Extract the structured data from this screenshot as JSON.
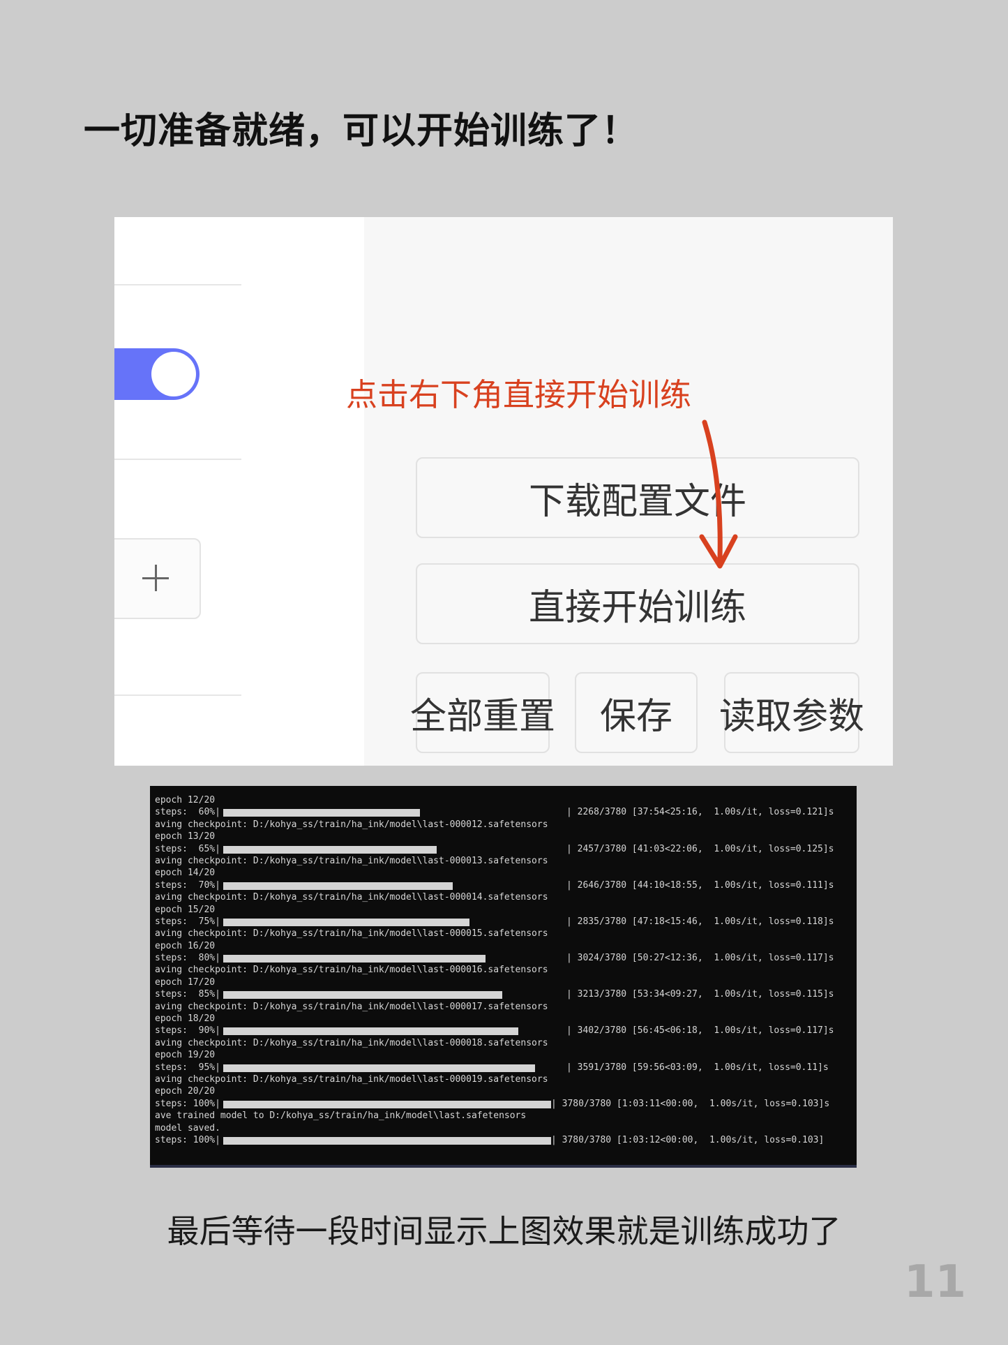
{
  "headline": "一切准备就绪，可以开始训练了！",
  "annotation": "点击右下角直接开始训练",
  "buttons": {
    "download_config": "下载配置文件",
    "start_training": "直接开始训练",
    "reset_all": "全部重置",
    "save": "保存",
    "load_params": "读取参数"
  },
  "colors": {
    "toggle_on": "#6673f9",
    "annotation": "#d8411f",
    "terminal_bg": "#0c0c0c"
  },
  "terminal": {
    "lines": [
      {
        "kind": "text",
        "text": "epoch 12/20"
      },
      {
        "kind": "steps",
        "label": "steps:  60%|",
        "progress": 0.6,
        "info": "| 2268/3780 [37:54<25:16,  1.00s/it, loss=0.121]s"
      },
      {
        "kind": "text",
        "text": "aving checkpoint: D:/kohya_ss/train/ha_ink/model\\last-000012.safetensors"
      },
      {
        "kind": "text",
        "text": "epoch 13/20"
      },
      {
        "kind": "steps",
        "label": "steps:  65%|",
        "progress": 0.65,
        "info": "| 2457/3780 [41:03<22:06,  1.00s/it, loss=0.125]s"
      },
      {
        "kind": "text",
        "text": "aving checkpoint: D:/kohya_ss/train/ha_ink/model\\last-000013.safetensors"
      },
      {
        "kind": "text",
        "text": "epoch 14/20"
      },
      {
        "kind": "steps",
        "label": "steps:  70%|",
        "progress": 0.7,
        "info": "| 2646/3780 [44:10<18:55,  1.00s/it, loss=0.111]s"
      },
      {
        "kind": "text",
        "text": "aving checkpoint: D:/kohya_ss/train/ha_ink/model\\last-000014.safetensors"
      },
      {
        "kind": "text",
        "text": "epoch 15/20"
      },
      {
        "kind": "steps",
        "label": "steps:  75%|",
        "progress": 0.75,
        "info": "| 2835/3780 [47:18<15:46,  1.00s/it, loss=0.118]s"
      },
      {
        "kind": "text",
        "text": "aving checkpoint: D:/kohya_ss/train/ha_ink/model\\last-000015.safetensors"
      },
      {
        "kind": "text",
        "text": "epoch 16/20"
      },
      {
        "kind": "steps",
        "label": "steps:  80%|",
        "progress": 0.8,
        "info": "| 3024/3780 [50:27<12:36,  1.00s/it, loss=0.117]s"
      },
      {
        "kind": "text",
        "text": "aving checkpoint: D:/kohya_ss/train/ha_ink/model\\last-000016.safetensors"
      },
      {
        "kind": "text",
        "text": "epoch 17/20"
      },
      {
        "kind": "steps",
        "label": "steps:  85%|",
        "progress": 0.85,
        "info": "| 3213/3780 [53:34<09:27,  1.00s/it, loss=0.115]s"
      },
      {
        "kind": "text",
        "text": "aving checkpoint: D:/kohya_ss/train/ha_ink/model\\last-000017.safetensors"
      },
      {
        "kind": "text",
        "text": "epoch 18/20"
      },
      {
        "kind": "steps",
        "label": "steps:  90%|",
        "progress": 0.9,
        "info": "| 3402/3780 [56:45<06:18,  1.00s/it, loss=0.117]s"
      },
      {
        "kind": "text",
        "text": "aving checkpoint: D:/kohya_ss/train/ha_ink/model\\last-000018.safetensors"
      },
      {
        "kind": "text",
        "text": "epoch 19/20"
      },
      {
        "kind": "steps",
        "label": "steps:  95%|",
        "progress": 0.95,
        "info": "| 3591/3780 [59:56<03:09,  1.00s/it, loss=0.11]s"
      },
      {
        "kind": "text",
        "text": "aving checkpoint: D:/kohya_ss/train/ha_ink/model\\last-000019.safetensors"
      },
      {
        "kind": "text",
        "text": "epoch 20/20"
      },
      {
        "kind": "steps",
        "label": "steps: 100%|",
        "progress": 1.0,
        "info": "| 3780/3780 [1:03:11<00:00,  1.00s/it, loss=0.103]s"
      },
      {
        "kind": "text",
        "text": "ave trained model to D:/kohya_ss/train/ha_ink/model\\last.safetensors"
      },
      {
        "kind": "text",
        "text": "model saved."
      },
      {
        "kind": "steps",
        "label": "steps: 100%|",
        "progress": 1.0,
        "info": "| 3780/3780 [1:03:12<00:00,  1.00s/it, loss=0.103]"
      }
    ]
  },
  "caption": "最后等待一段时间显示上图效果就是训练成功了",
  "page_number": "11"
}
